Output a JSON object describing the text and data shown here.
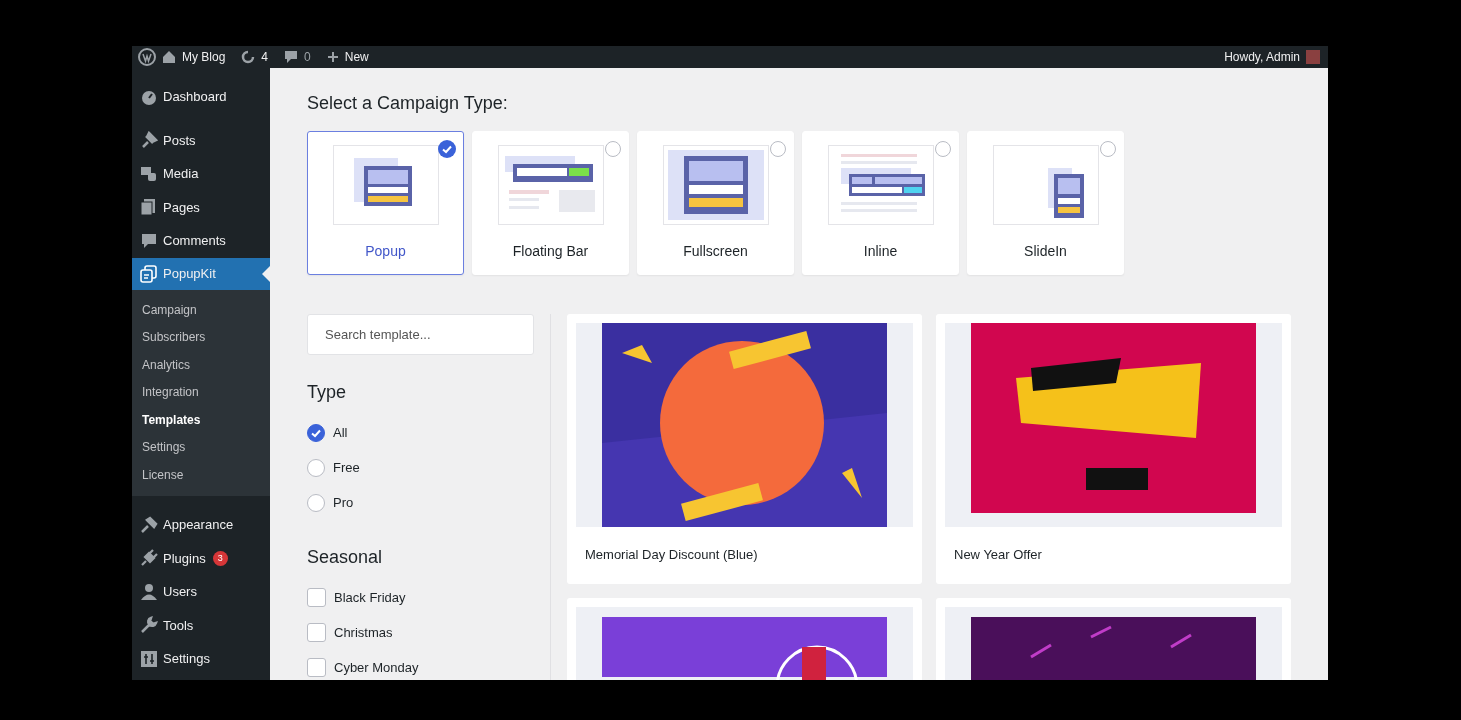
{
  "admin_bar": {
    "site": "My Blog",
    "updates": "4",
    "comments": "0",
    "new_label": "New",
    "greeting": "Howdy, Admin"
  },
  "sidebar": {
    "items": [
      {
        "label": "Dashboard",
        "selected": false
      },
      {
        "label": "Posts",
        "selected": false
      },
      {
        "label": "Media",
        "selected": false
      },
      {
        "label": "Pages",
        "selected": false
      },
      {
        "label": "Comments",
        "selected": false
      },
      {
        "label": "PopupKit",
        "selected": true,
        "children": [
          {
            "label": "Campaign",
            "selected": false
          },
          {
            "label": "Subscribers",
            "selected": false
          },
          {
            "label": "Analytics",
            "selected": false
          },
          {
            "label": "Integration",
            "selected": false
          },
          {
            "label": "Templates",
            "selected": true
          },
          {
            "label": "Settings",
            "selected": false
          },
          {
            "label": "License",
            "selected": false
          }
        ]
      },
      {
        "label": "Appearance",
        "selected": false
      },
      {
        "label": "Plugins",
        "selected": false,
        "badge": "3"
      },
      {
        "label": "Users",
        "selected": false
      },
      {
        "label": "Tools",
        "selected": false
      },
      {
        "label": "Settings",
        "selected": false
      }
    ]
  },
  "campaign": {
    "title": "Select a Campaign Type:",
    "types": [
      {
        "label": "Popup",
        "kind": "popup",
        "selected": true
      },
      {
        "label": "Floating Bar",
        "kind": "floating",
        "selected": false
      },
      {
        "label": "Fullscreen",
        "kind": "fullscreen",
        "selected": false
      },
      {
        "label": "Inline",
        "kind": "inline",
        "selected": false
      },
      {
        "label": "SlideIn",
        "kind": "slidein",
        "selected": false
      }
    ]
  },
  "filters": {
    "search": {
      "placeholder": "Search template..."
    },
    "type": {
      "title": "Type",
      "options": [
        {
          "label": "All",
          "selected": true
        },
        {
          "label": "Free",
          "selected": false
        },
        {
          "label": "Pro",
          "selected": false
        }
      ]
    },
    "seasonal": {
      "title": "Seasonal",
      "options": [
        {
          "label": "Black Friday",
          "checked": false
        },
        {
          "label": "Christmas",
          "checked": false
        },
        {
          "label": "Cyber Monday",
          "checked": false
        }
      ]
    }
  },
  "templates": [
    {
      "title": "Memorial Day Discount (Blue)",
      "kind": "blue"
    },
    {
      "title": "New Year Offer",
      "kind": "red"
    },
    {
      "kind": "purple"
    },
    {
      "kind": "dark"
    }
  ]
}
